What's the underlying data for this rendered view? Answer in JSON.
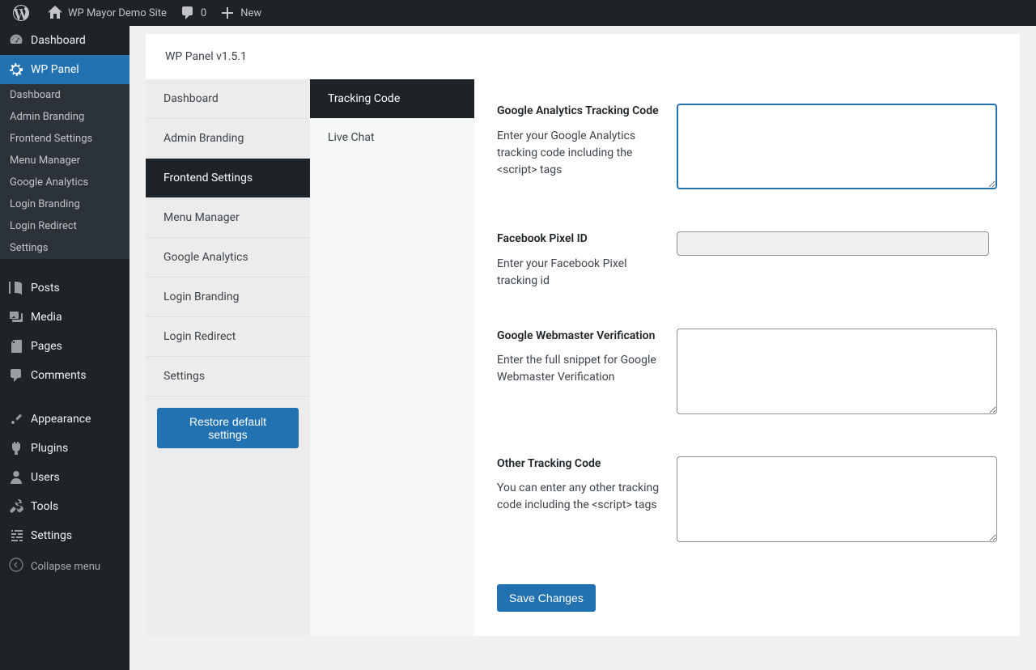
{
  "adminBar": {
    "siteName": "WP Mayor Demo Site",
    "commentsCount": "0",
    "newLabel": "New"
  },
  "sidebar": {
    "dashboard": "Dashboard",
    "wpPanel": "WP Panel",
    "submenu": {
      "dashboard": "Dashboard",
      "adminBranding": "Admin Branding",
      "frontendSettings": "Frontend Settings",
      "menuManager": "Menu Manager",
      "googleAnalytics": "Google Analytics",
      "loginBranding": "Login Branding",
      "loginRedirect": "Login Redirect",
      "settings": "Settings"
    },
    "posts": "Posts",
    "media": "Media",
    "pages": "Pages",
    "comments": "Comments",
    "appearance": "Appearance",
    "plugins": "Plugins",
    "users": "Users",
    "tools": "Tools",
    "settings": "Settings",
    "collapse": "Collapse menu"
  },
  "panel": {
    "title": "WP Panel v1.5.1",
    "tabs": {
      "dashboard": "Dashboard",
      "adminBranding": "Admin Branding",
      "frontendSettings": "Frontend Settings",
      "menuManager": "Menu Manager",
      "googleAnalytics": "Google Analytics",
      "loginBranding": "Login Branding",
      "loginRedirect": "Login Redirect",
      "settings": "Settings"
    },
    "restoreBtn": "Restore default settings",
    "subtabs": {
      "trackingCode": "Tracking Code",
      "liveChat": "Live Chat"
    }
  },
  "form": {
    "ga": {
      "label": "Google Analytics Tracking Code",
      "desc": "Enter your Google Analytics tracking code including the <script> tags"
    },
    "fb": {
      "label": "Facebook Pixel ID",
      "desc": "Enter your Facebook Pixel tracking id"
    },
    "gwm": {
      "label": "Google Webmaster Verification",
      "desc": "Enter the full snippet for Google Webmaster Verification"
    },
    "other": {
      "label": "Other Tracking Code",
      "desc": "You can enter any other tracking code including the <script> tags"
    },
    "save": "Save Changes"
  }
}
